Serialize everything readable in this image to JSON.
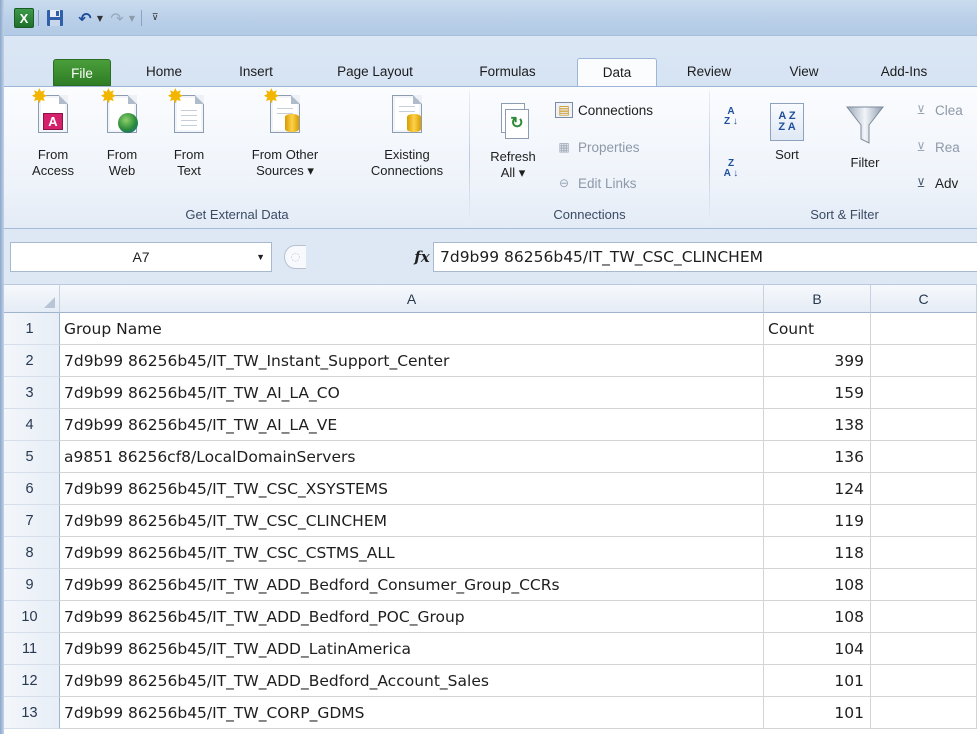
{
  "quick_access": {
    "app_letter": "X"
  },
  "tabs": [
    "File",
    "Home",
    "Insert",
    "Page Layout",
    "Formulas",
    "Data",
    "Review",
    "View",
    "Add-Ins"
  ],
  "ribbon": {
    "get_external": {
      "label": "Get External Data",
      "from_access": [
        "From",
        "Access"
      ],
      "from_web": [
        "From",
        "Web"
      ],
      "from_text": [
        "From",
        "Text"
      ],
      "from_other": [
        "From Other",
        "Sources ▾"
      ],
      "existing": [
        "Existing",
        "Connections"
      ]
    },
    "connections": {
      "label": "Connections",
      "refresh": [
        "Refresh",
        "All ▾"
      ],
      "connections": "Connections",
      "properties": "Properties",
      "edit_links": "Edit Links"
    },
    "sort_filter": {
      "label": "Sort & Filter",
      "sort": "Sort",
      "filter": "Filter",
      "clear": "Clea",
      "reapply": "Rea",
      "advanced": "Adv"
    }
  },
  "formula_bar": {
    "name_box": "A7",
    "fx": "fx",
    "formula": "7d9b99 86256b45/IT_TW_CSC_CLINCHEM"
  },
  "grid": {
    "columns": [
      "A",
      "B",
      "C"
    ],
    "rows": [
      {
        "n": "1",
        "a": "Group Name",
        "b": "Count"
      },
      {
        "n": "2",
        "a": "7d9b99 86256b45/IT_TW_Instant_Support_Center",
        "b": "399"
      },
      {
        "n": "3",
        "a": "7d9b99 86256b45/IT_TW_AI_LA_CO",
        "b": "159"
      },
      {
        "n": "4",
        "a": "7d9b99 86256b45/IT_TW_AI_LA_VE",
        "b": "138"
      },
      {
        "n": "5",
        "a": "a9851 86256cf8/LocalDomainServers",
        "b": "136"
      },
      {
        "n": "6",
        "a": "7d9b99 86256b45/IT_TW_CSC_XSYSTEMS",
        "b": "124"
      },
      {
        "n": "7",
        "a": "7d9b99 86256b45/IT_TW_CSC_CLINCHEM",
        "b": "119"
      },
      {
        "n": "8",
        "a": "7d9b99 86256b45/IT_TW_CSC_CSTMS_ALL",
        "b": "118"
      },
      {
        "n": "9",
        "a": "7d9b99 86256b45/IT_TW_ADD_Bedford_Consumer_Group_CCRs",
        "b": "108"
      },
      {
        "n": "10",
        "a": "7d9b99 86256b45/IT_TW_ADD_Bedford_POC_Group",
        "b": "108"
      },
      {
        "n": "11",
        "a": "7d9b99 86256b45/IT_TW_ADD_LatinAmerica",
        "b": "104"
      },
      {
        "n": "12",
        "a": "7d9b99 86256b45/IT_TW_ADD_Bedford_Account_Sales",
        "b": "101"
      },
      {
        "n": "13",
        "a": "7d9b99 86256b45/IT_TW_CORP_GDMS",
        "b": "101"
      }
    ]
  }
}
